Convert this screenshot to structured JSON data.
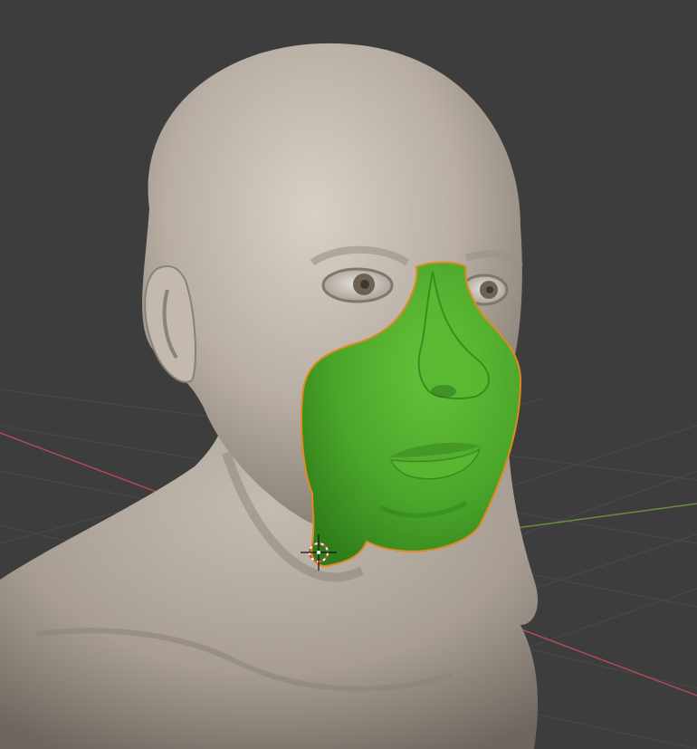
{
  "app": {
    "type": "3d-viewport",
    "view": "perspective"
  },
  "scene": {
    "background_color": "#3d3d3d",
    "grid_line_color": "#4a4a4a",
    "x_axis_color": "#b04a55",
    "y_axis_color": "#6a8f3a",
    "bust_color": "#b8aea3",
    "bust_shadow_color": "#8d847b",
    "selected_object_color": "#4fa82c",
    "selection_outline_color": "#e08a1e",
    "cursor_color": "#ffffff",
    "cursor_ring_color": "#d64545"
  },
  "objects": [
    {
      "name": "head-bust",
      "selected": false
    },
    {
      "name": "face-mask",
      "selected": true
    }
  ],
  "cursor": {
    "name": "3d-cursor"
  }
}
